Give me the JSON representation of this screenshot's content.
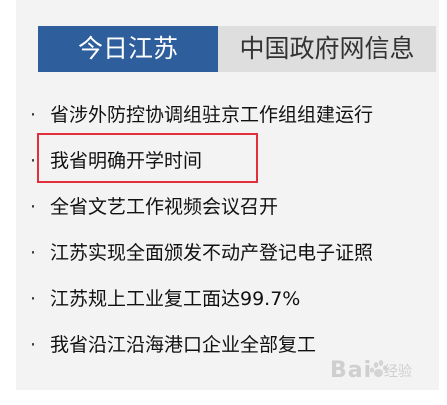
{
  "tabs": [
    {
      "label": "今日江苏",
      "active": true
    },
    {
      "label": "中国政府网信息",
      "active": false
    }
  ],
  "bullet_char": "·",
  "news_items": [
    {
      "title": "省涉外防控协调组驻京工作组组建运行"
    },
    {
      "title": "我省明确开学时间"
    },
    {
      "title": "全省文艺工作视频会议召开"
    },
    {
      "title": "江苏实现全面颁发不动产登记电子证照"
    },
    {
      "title": "江苏规上工业复工面达99.7%"
    },
    {
      "title": "我省沿江沿海港口企业全部复工"
    }
  ],
  "highlighted_index": 1,
  "watermark": {
    "logo_text": "Bai",
    "sub_text": "经验"
  },
  "colors": {
    "tab_active_bg": "#2f5e9d",
    "tab_inactive_bg": "#dedede",
    "highlight_border": "#e2303a",
    "panel_bg": "#f3f3f3"
  }
}
